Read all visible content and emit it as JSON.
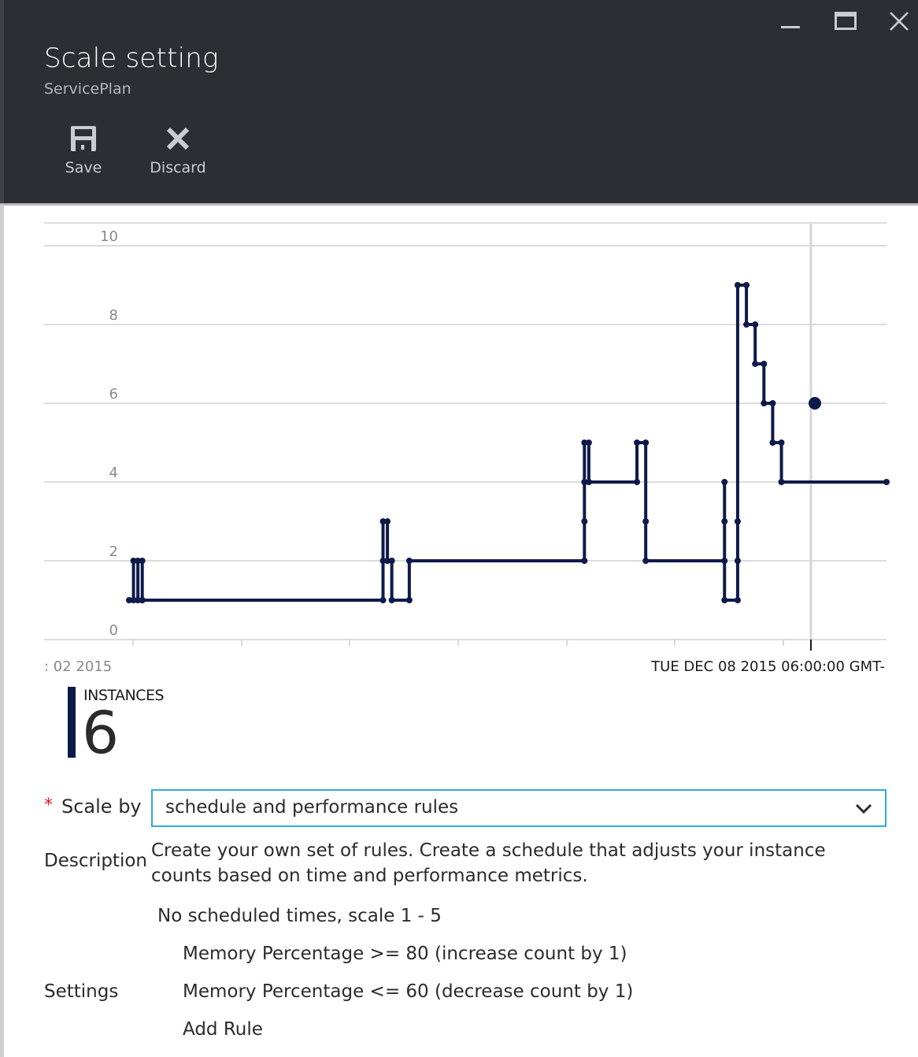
{
  "header": {
    "title": "Scale setting",
    "subtitle": "ServicePlan",
    "save_label": "Save",
    "discard_label": "Discard",
    "icons": {
      "minimize": "minimize-icon",
      "maximize": "maximize-icon",
      "close": "close-icon",
      "save": "save-icon",
      "discard": "discard-icon"
    }
  },
  "colors": {
    "header_bg": "#2b2e33",
    "series": "#0e1a4a",
    "accent": "#33a8df",
    "required": "#e81123",
    "grid": "#c8c8c8"
  },
  "chart_data": {
    "type": "line",
    "step": true,
    "yticks": [
      "0",
      "2",
      "4",
      "6",
      "8",
      "10"
    ],
    "ylim": [
      0,
      10
    ],
    "grid": true,
    "xlim": [
      0,
      173
    ],
    "xaxis_label_fragment": "02 2015",
    "hover_date_label": "TUE DEC 08 2015 06:00:00 GMT-",
    "hover_value": 6,
    "series": [
      {
        "values": [
          [
            0,
            1
          ],
          [
            1,
            1
          ],
          [
            1,
            2
          ],
          [
            2,
            2
          ],
          [
            2,
            1
          ],
          [
            3,
            1
          ],
          [
            3,
            2
          ],
          [
            3,
            1
          ],
          [
            58,
            1
          ],
          [
            58,
            2
          ],
          [
            58,
            3
          ],
          [
            59,
            3
          ],
          [
            59,
            2
          ],
          [
            60,
            2
          ],
          [
            60,
            1
          ],
          [
            64,
            1
          ],
          [
            64,
            2
          ],
          [
            104,
            2
          ],
          [
            104,
            3
          ],
          [
            104,
            4
          ],
          [
            104,
            5
          ],
          [
            105,
            5
          ],
          [
            105,
            4
          ],
          [
            116,
            4
          ],
          [
            116,
            5
          ],
          [
            118,
            5
          ],
          [
            118,
            3
          ],
          [
            118,
            2
          ],
          [
            136,
            2
          ],
          [
            136,
            3
          ],
          [
            136,
            4
          ],
          [
            136,
            1
          ],
          [
            139,
            1
          ],
          [
            139,
            2
          ],
          [
            139,
            3
          ],
          [
            139,
            9
          ],
          [
            141,
            9
          ],
          [
            141,
            8
          ],
          [
            143,
            8
          ],
          [
            143,
            7
          ],
          [
            145,
            7
          ],
          [
            145,
            6
          ],
          [
            147,
            6
          ],
          [
            147,
            5
          ],
          [
            149,
            5
          ],
          [
            149,
            4
          ],
          [
            173,
            4
          ]
        ]
      }
    ]
  },
  "instances": {
    "label": "INSTANCES",
    "value": "6"
  },
  "form": {
    "scale_by_required": "*",
    "scale_by_label": "Scale by",
    "scale_by_value": "schedule and performance rules",
    "description_label": "Description",
    "description_text": "Create your own set of rules. Create a schedule that adjusts your instance counts based on time and performance metrics.",
    "schedule_summary": "No scheduled times, scale 1 - 5",
    "rules": [
      "Memory Percentage >= 80 (increase count by 1)",
      "Memory Percentage <= 60 (decrease count by 1)"
    ],
    "add_rule_label": "Add Rule",
    "settings_label": "Settings"
  }
}
